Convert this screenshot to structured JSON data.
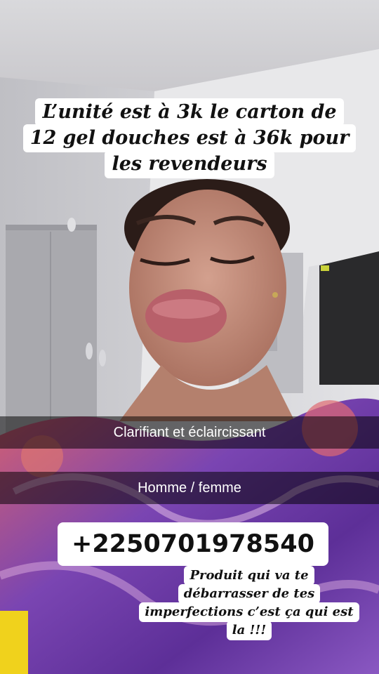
{
  "overlay": {
    "top_caption_lines": [
      "L’unité est à 3k le carton de",
      "12 gel douches est à 36k pour",
      "les revendeurs"
    ],
    "bar_1_text": "Clarifiant et éclaircissant",
    "bar_2_text": "Homme / femme",
    "phone_number": "+2250701978540",
    "bottom_caption_lines": [
      "Produit qui va te",
      "débarrasser de tes",
      "imperfections c’est ça qui est",
      "la !!!"
    ]
  },
  "colors": {
    "caption_background": "#ffffff",
    "caption_text": "#111111",
    "bar_background": "rgba(0,0,0,0.52)",
    "bar_text": "#ffffff",
    "dress_purple": "#6a3aa8",
    "dress_pink": "#e0626e"
  }
}
